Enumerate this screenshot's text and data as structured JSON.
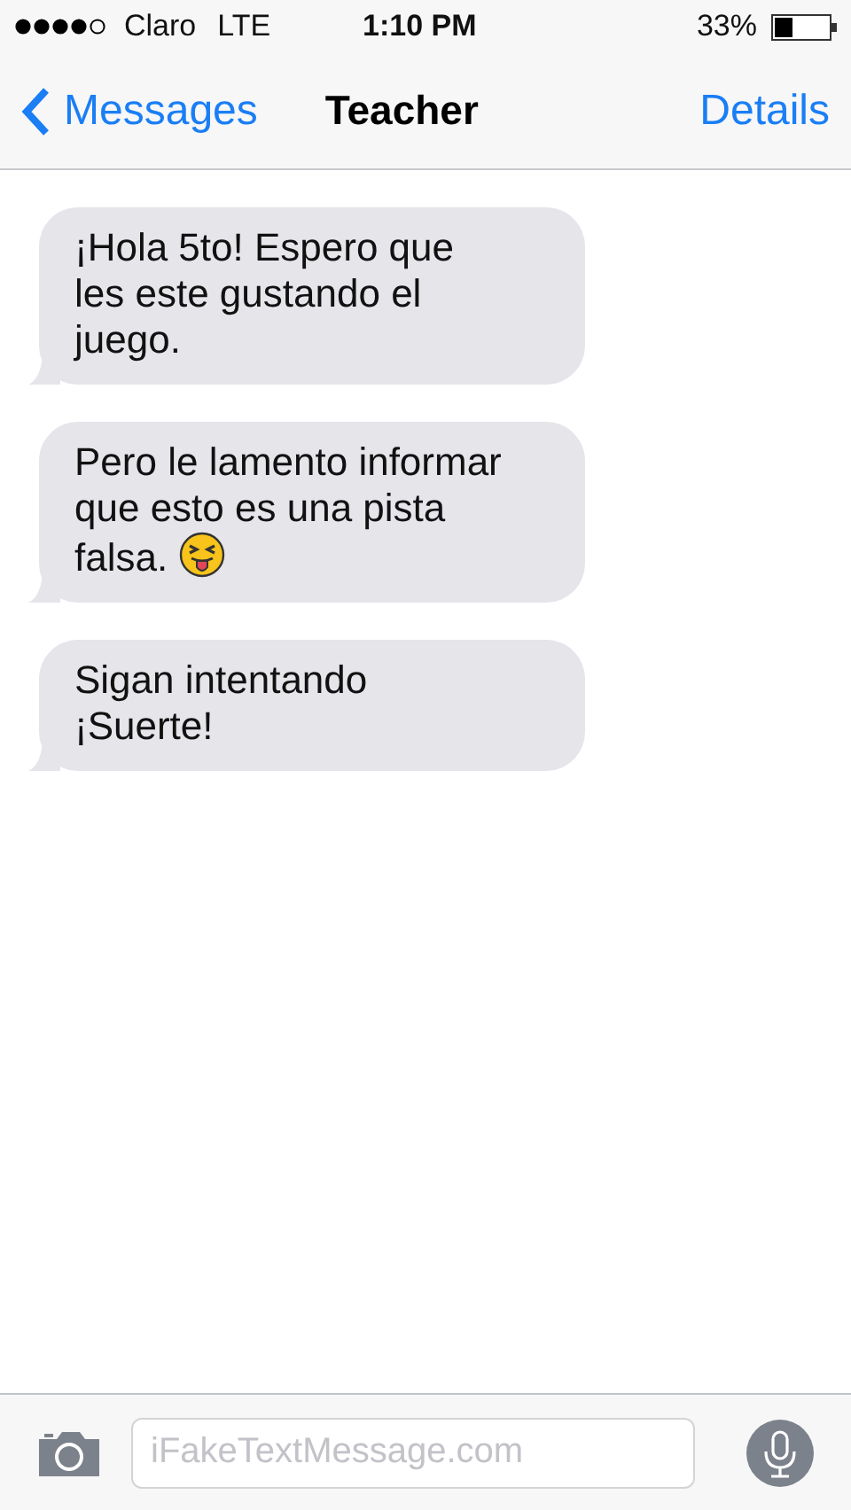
{
  "status_bar": {
    "carrier": "Claro",
    "network": "LTE",
    "time": "1:10 PM",
    "battery": "33%"
  },
  "nav": {
    "back": "Messages",
    "title": "Teacher",
    "action": "Details"
  },
  "messages": [
    {
      "text": "¡Hola 5to! Espero que\nles este gustando el\njuego.",
      "emoji": false
    },
    {
      "text": "Pero le lamento informar\nque esto es una pista\nfalsa.",
      "emoji": true
    },
    {
      "text": "Sigan intentando\n¡Suerte!",
      "emoji": false
    }
  ],
  "composer": {
    "placeholder": "iFakeTextMessage.com"
  }
}
